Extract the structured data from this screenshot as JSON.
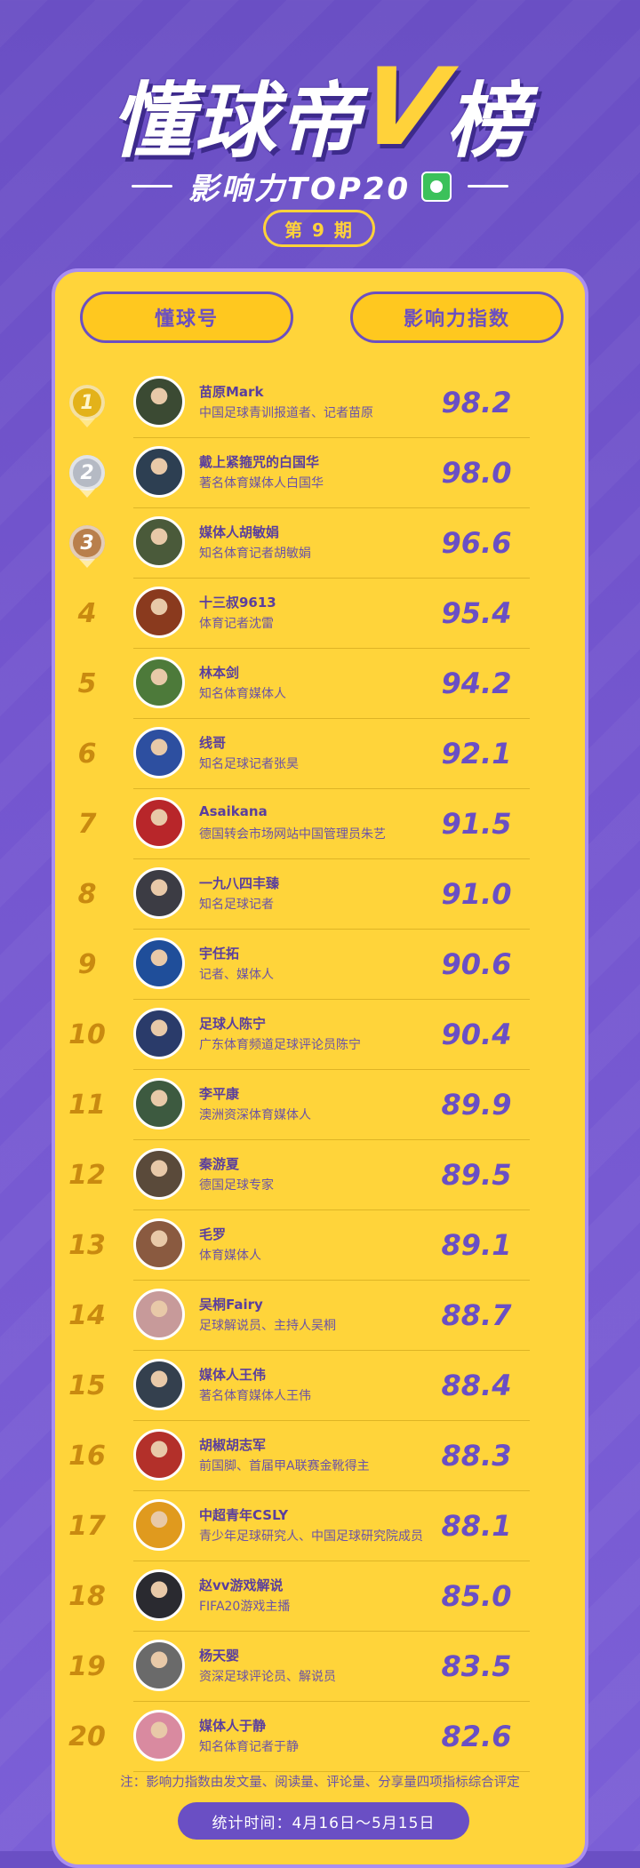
{
  "header": {
    "title_main": "懂球帝",
    "title_v": "V",
    "title_tail": "榜",
    "subtitle": "影响力TOP20",
    "issue": "第 9 期"
  },
  "table": {
    "col_account": "懂球号",
    "col_index": "影响力指数"
  },
  "rows": [
    {
      "rank": "1",
      "name": "苗原Mark",
      "desc": "中国足球青训报道者、记者苗原",
      "score": "98.2",
      "avatar_color": "#3b4a33"
    },
    {
      "rank": "2",
      "name": "戴上紧箍咒的白国华",
      "desc": "著名体育媒体人白国华",
      "score": "98.0",
      "avatar_color": "#2d3f52"
    },
    {
      "rank": "3",
      "name": "媒体人胡敏娟",
      "desc": "知名体育记者胡敏娟",
      "score": "96.6",
      "avatar_color": "#4a5a3a"
    },
    {
      "rank": "4",
      "name": "十三叔9613",
      "desc": "体育记者沈雷",
      "score": "95.4",
      "avatar_color": "#8a3a1e"
    },
    {
      "rank": "5",
      "name": "林本剑",
      "desc": "知名体育媒体人",
      "score": "94.2",
      "avatar_color": "#4d7a3a"
    },
    {
      "rank": "6",
      "name": "线哥",
      "desc": "知名足球记者张昊",
      "score": "92.1",
      "avatar_color": "#2d4fa0"
    },
    {
      "rank": "7",
      "name": "Asaikana",
      "desc": "德国转会市场网站中国管理员朱艺",
      "score": "91.5",
      "avatar_color": "#b8262a"
    },
    {
      "rank": "8",
      "name": "一九八四丰臻",
      "desc": "知名足球记者",
      "score": "91.0",
      "avatar_color": "#3c3c44"
    },
    {
      "rank": "9",
      "name": "宇任拓",
      "desc": "记者、媒体人",
      "score": "90.6",
      "avatar_color": "#1f4e9a"
    },
    {
      "rank": "10",
      "name": "足球人陈宁",
      "desc": "广东体育频道足球评论员陈宁",
      "score": "90.4",
      "avatar_color": "#2a3b6a"
    },
    {
      "rank": "11",
      "name": "李平康",
      "desc": "澳洲资深体育媒体人",
      "score": "89.9",
      "avatar_color": "#3d5a40"
    },
    {
      "rank": "12",
      "name": "秦游夏",
      "desc": "德国足球专家",
      "score": "89.5",
      "avatar_color": "#5a4a3a"
    },
    {
      "rank": "13",
      "name": "毛罗",
      "desc": "体育媒体人",
      "score": "89.1",
      "avatar_color": "#8a5a40"
    },
    {
      "rank": "14",
      "name": "吴桐Fairy",
      "desc": "足球解说员、主持人吴桐",
      "score": "88.7",
      "avatar_color": "#c79a9a"
    },
    {
      "rank": "15",
      "name": "媒体人王伟",
      "desc": "著名体育媒体人王伟",
      "score": "88.4",
      "avatar_color": "#34404e"
    },
    {
      "rank": "16",
      "name": "胡椒胡志军",
      "desc": "前国脚、首届甲A联赛金靴得主",
      "score": "88.3",
      "avatar_color": "#b3302a"
    },
    {
      "rank": "17",
      "name": "中超青年CSLY",
      "desc": "青少年足球研究人、中国足球研究院成员",
      "score": "88.1",
      "avatar_color": "#e09a1e"
    },
    {
      "rank": "18",
      "name": "赵vv游戏解说",
      "desc": "FIFA20游戏主播",
      "score": "85.0",
      "avatar_color": "#2a2a30"
    },
    {
      "rank": "19",
      "name": "杨天婴",
      "desc": "资深足球评论员、解说员",
      "score": "83.5",
      "avatar_color": "#6a6a6a"
    },
    {
      "rank": "20",
      "name": "媒体人于静",
      "desc": "知名体育记者于静",
      "score": "82.6",
      "avatar_color": "#d98aa0"
    }
  ],
  "footer": {
    "note": "注：影响力指数由发文量、阅读量、评论量、分享量四项指标综合评定",
    "period": "统计时间：4月16日～5月15日"
  }
}
